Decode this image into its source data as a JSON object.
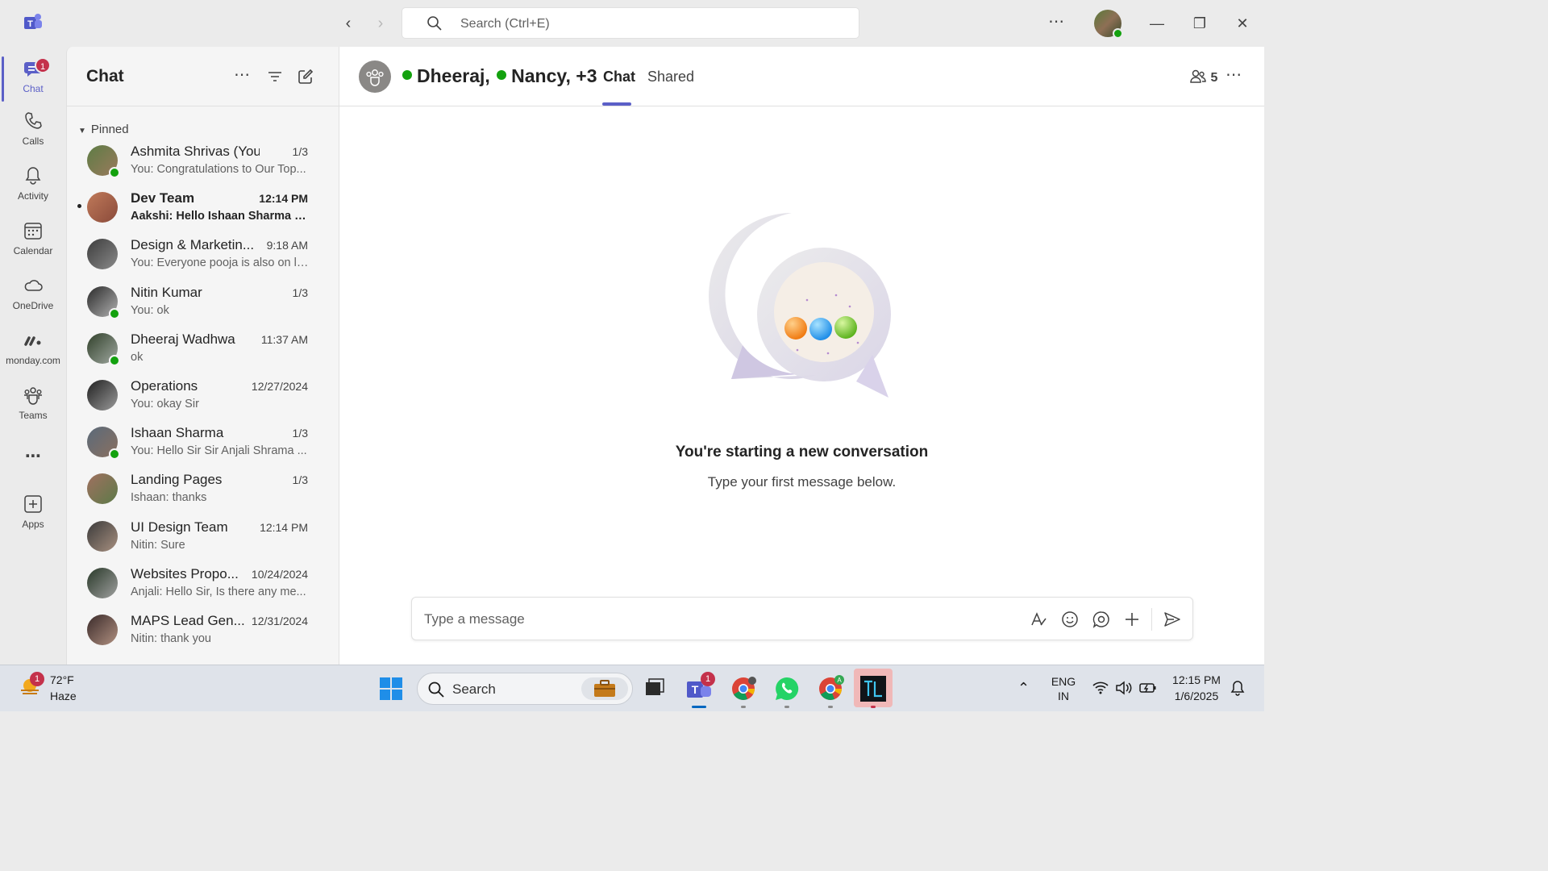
{
  "titlebar": {
    "search_placeholder": "Search (Ctrl+E)"
  },
  "rail": {
    "items": [
      {
        "label": "Chat",
        "badge": "1"
      },
      {
        "label": "Calls"
      },
      {
        "label": "Activity"
      },
      {
        "label": "Calendar"
      },
      {
        "label": "OneDrive"
      },
      {
        "label": "monday.com"
      },
      {
        "label": "Teams"
      },
      {
        "label": "Apps"
      }
    ]
  },
  "chat_pane": {
    "title": "Chat",
    "section": "Pinned",
    "chats": [
      {
        "name": "Ashmita Shrivas (You)",
        "time": "1/3",
        "preview": "You: Congratulations to Our Top...",
        "presence": true,
        "unread": false
      },
      {
        "name": "Dev Team",
        "time": "12:14 PM",
        "preview": "Aakshi: Hello Ishaan Sharma sir...",
        "presence": false,
        "unread": true
      },
      {
        "name": "Design & Marketin...",
        "time": "9:18 AM",
        "preview": "You: Everyone pooja is also on le...",
        "presence": false,
        "unread": false
      },
      {
        "name": "Nitin Kumar",
        "time": "1/3",
        "preview": "You: ok",
        "presence": true,
        "unread": false
      },
      {
        "name": "Dheeraj Wadhwa",
        "time": "11:37 AM",
        "preview": "ok",
        "presence": true,
        "unread": false
      },
      {
        "name": "Operations",
        "time": "12/27/2024",
        "preview": "You: okay Sir",
        "presence": false,
        "unread": false
      },
      {
        "name": "Ishaan Sharma",
        "time": "1/3",
        "preview": "You: Hello Sir  Sir Anjali Shrama ...",
        "presence": true,
        "unread": false
      },
      {
        "name": "Landing Pages",
        "time": "1/3",
        "preview": "Ishaan: thanks",
        "presence": false,
        "unread": false
      },
      {
        "name": "UI Design Team",
        "time": "12:14 PM",
        "preview": "Nitin: Sure",
        "presence": false,
        "unread": false
      },
      {
        "name": "Websites Propo...",
        "time": "10/24/2024",
        "preview": "Anjali: Hello Sir, Is there any me...",
        "presence": false,
        "unread": false
      },
      {
        "name": "MAPS Lead Gen...",
        "time": "12/31/2024",
        "preview": "Nitin: thank you",
        "presence": false,
        "unread": false
      }
    ]
  },
  "conversation": {
    "name_1": "Dheeraj,",
    "name_2": "Nancy",
    "extra": ", +3",
    "tabs": [
      "Chat",
      "Shared"
    ],
    "participants": "5",
    "empty_title": "You're starting a new conversation",
    "empty_subtitle": "Type your first message below.",
    "compose_placeholder": "Type a message"
  },
  "taskbar": {
    "weather_temp": "72°F",
    "weather_desc": "Haze",
    "weather_badge": "1",
    "search_placeholder": "Search",
    "teams_badge": "1",
    "lang_1": "ENG",
    "lang_2": "IN",
    "time": "12:15 PM",
    "date": "1/6/2025"
  },
  "colors": {
    "accent": "#5b5fc7",
    "presence": "#13a10e",
    "badge": "#c4314b"
  }
}
